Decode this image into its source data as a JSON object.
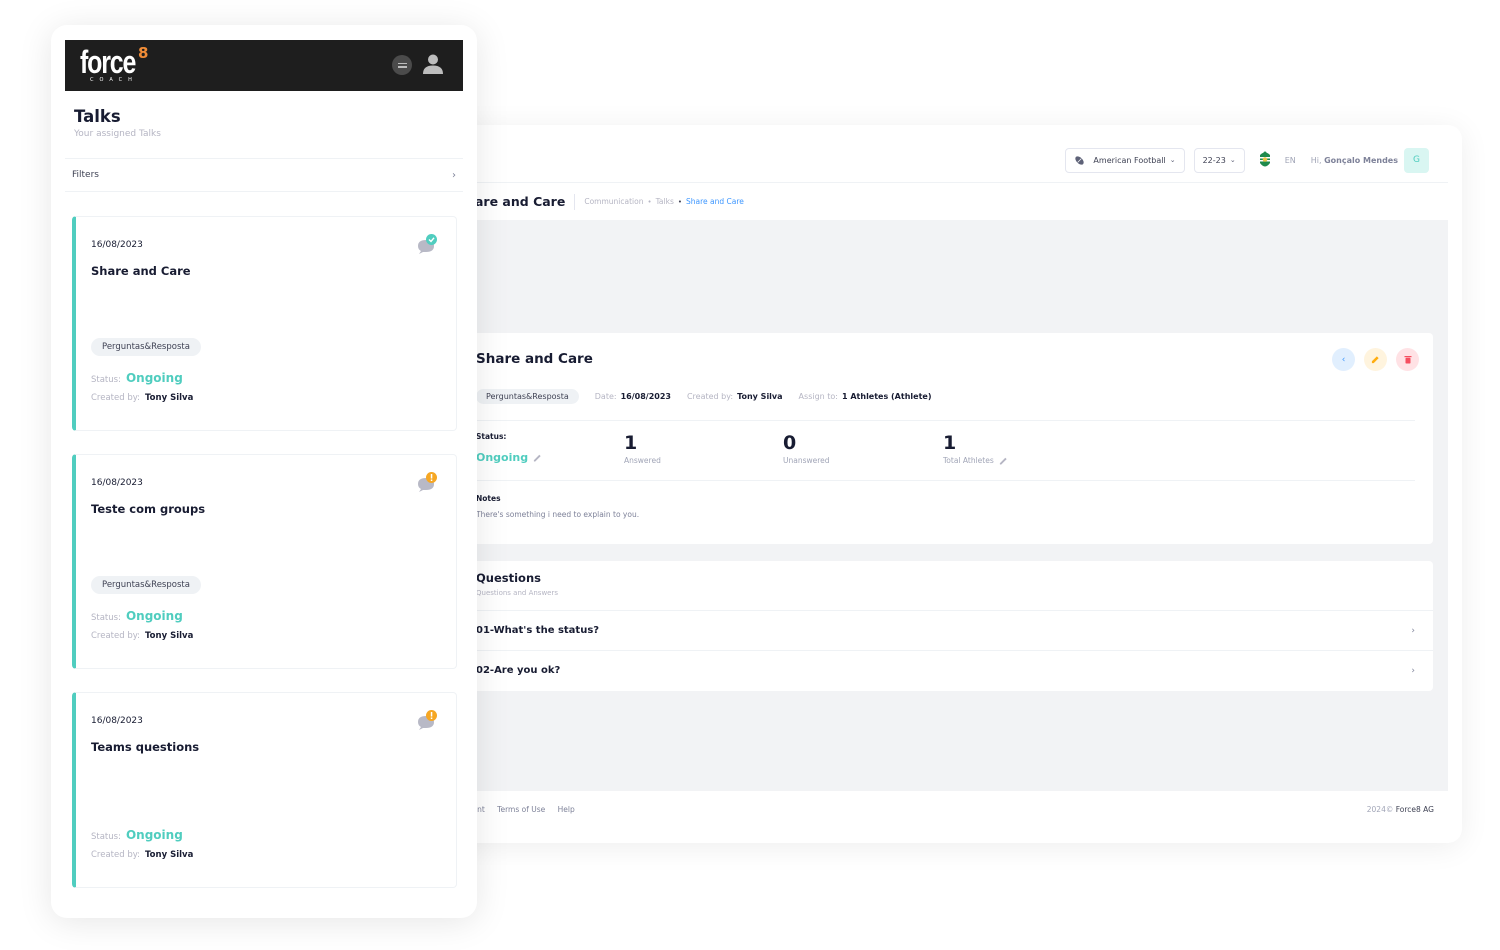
{
  "desktop": {
    "header": {
      "sport_select": {
        "value": "American Football",
        "icon": "football-icon"
      },
      "season_select": {
        "value": "22-23"
      },
      "club_logo": "club-crest-icon",
      "language": "EN",
      "greeting_prefix": "Hi,",
      "user_name": "Gonçalo Mendes",
      "avatar_initial": "G"
    },
    "breadcrumb": {
      "page_title": "are and Care",
      "items": [
        "Communication",
        "Talks",
        "Share and Care"
      ]
    },
    "talk_detail": {
      "title": "Share and Care",
      "actions": [
        "back",
        "edit",
        "delete"
      ],
      "tag": "Perguntas&Resposta",
      "date_label": "Date:",
      "date": "16/08/2023",
      "created_by_label": "Created by:",
      "created_by": "Tony Silva",
      "assign_label": "Assign to:",
      "assign_to": "1 Athletes (Athlete)",
      "status_label": "Status:",
      "status": "Ongoing",
      "stats": [
        {
          "value": "1",
          "label": "Answered"
        },
        {
          "value": "0",
          "label": "Unanswered"
        },
        {
          "value": "1",
          "label": "Total Athletes"
        }
      ],
      "notes_label": "Notes",
      "notes": "There's something i need to explain to you."
    },
    "questions": {
      "title": "Questions",
      "subtitle": "Questions and Answers",
      "items": [
        "01-What's the status?",
        "02-Are you ok?"
      ]
    },
    "footer": {
      "links": [
        "int",
        "Terms of Use",
        "Help"
      ],
      "year": "2024©",
      "company": "Force8 AG"
    }
  },
  "mobile": {
    "brand": {
      "word": "force",
      "superscript": "8",
      "tagline": "COACH"
    },
    "page_title": "Talks",
    "page_subtitle": "Your assigned Talks",
    "filters_label": "Filters",
    "status_label": "Status:",
    "created_by_label": "Created by:",
    "talks": [
      {
        "date": "16/08/2023",
        "name": "Share and Care",
        "tag": "Perguntas&Resposta",
        "status": "Ongoing",
        "created_by": "Tony Silva",
        "badge": "check",
        "badge_color": "#50cdbf"
      },
      {
        "date": "16/08/2023",
        "name": "Teste com groups",
        "tag": "Perguntas&Resposta",
        "status": "Ongoing",
        "created_by": "Tony Silva",
        "badge": "alert",
        "badge_color": "#f6a723"
      },
      {
        "date": "16/08/2023",
        "name": "Teams questions",
        "tag": "",
        "status": "Ongoing",
        "created_by": "Tony Silva",
        "badge": "alert",
        "badge_color": "#f6a723"
      }
    ]
  },
  "colors": {
    "accent_teal": "#50cdbf",
    "link_blue": "#3e97ff",
    "warning": "#f6a723",
    "danger": "#f64e60",
    "logo_orange": "#f08c37"
  }
}
